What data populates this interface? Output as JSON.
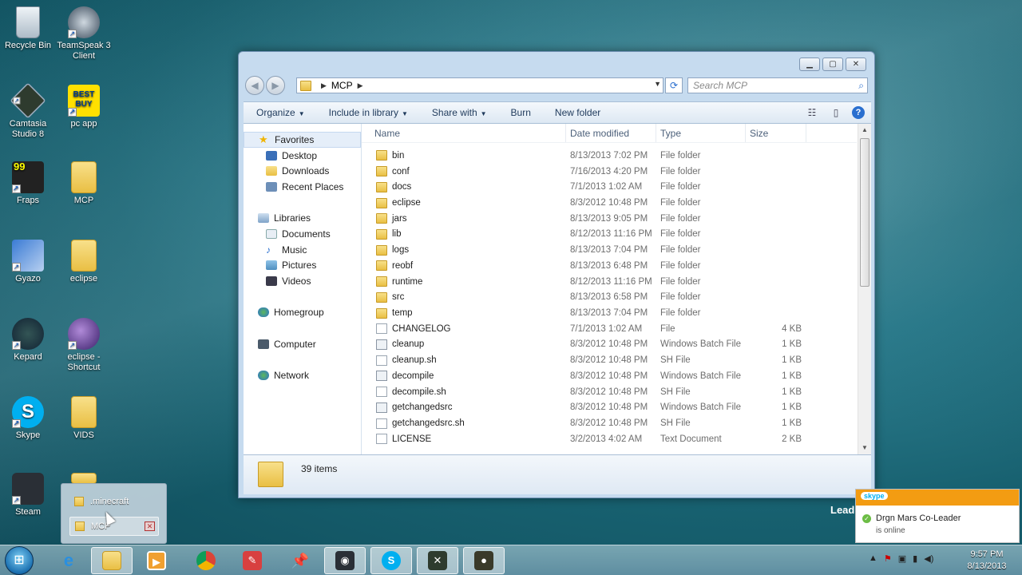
{
  "desktop": {
    "icons": [
      {
        "label": "Recycle Bin"
      },
      {
        "label": "TeamSpeak 3 Client"
      },
      {
        "label": "Camtasia Studio 8"
      },
      {
        "label": "pc app"
      },
      {
        "label": "Fraps"
      },
      {
        "label": "MCP"
      },
      {
        "label": "Gyazo"
      },
      {
        "label": "eclipse"
      },
      {
        "label": "Kepard"
      },
      {
        "label": "eclipse - Shortcut"
      },
      {
        "label": "Skype"
      },
      {
        "label": "VIDS"
      },
      {
        "label": "Steam"
      }
    ],
    "bestbuy_logo": "BEST BUY",
    "fraps_counter": "99",
    "lead_text": "Lead"
  },
  "explorer": {
    "breadcrumb": "MCP",
    "search_placeholder": "Search MCP",
    "toolbar": {
      "organize": "Organize",
      "include_in_library": "Include in library",
      "share_with": "Share with",
      "burn": "Burn",
      "new_folder": "New folder"
    },
    "nav": {
      "favorites": "Favorites",
      "desktop": "Desktop",
      "downloads": "Downloads",
      "recent_places": "Recent Places",
      "libraries": "Libraries",
      "documents": "Documents",
      "music": "Music",
      "pictures": "Pictures",
      "videos": "Videos",
      "homegroup": "Homegroup",
      "computer": "Computer",
      "network": "Network"
    },
    "columns": {
      "name": "Name",
      "date_modified": "Date modified",
      "type": "Type",
      "size": "Size"
    },
    "files": [
      {
        "name": "bin",
        "date": "8/13/2013 7:02 PM",
        "type": "File folder",
        "size": "",
        "icon": "folder"
      },
      {
        "name": "conf",
        "date": "7/16/2013 4:20 PM",
        "type": "File folder",
        "size": "",
        "icon": "folder"
      },
      {
        "name": "docs",
        "date": "7/1/2013 1:02 AM",
        "type": "File folder",
        "size": "",
        "icon": "folder"
      },
      {
        "name": "eclipse",
        "date": "8/3/2012 10:48 PM",
        "type": "File folder",
        "size": "",
        "icon": "folder"
      },
      {
        "name": "jars",
        "date": "8/13/2013 9:05 PM",
        "type": "File folder",
        "size": "",
        "icon": "folder"
      },
      {
        "name": "lib",
        "date": "8/12/2013 11:16 PM",
        "type": "File folder",
        "size": "",
        "icon": "folder"
      },
      {
        "name": "logs",
        "date": "8/13/2013 7:04 PM",
        "type": "File folder",
        "size": "",
        "icon": "folder"
      },
      {
        "name": "reobf",
        "date": "8/13/2013 6:48 PM",
        "type": "File folder",
        "size": "",
        "icon": "folder"
      },
      {
        "name": "runtime",
        "date": "8/12/2013 11:16 PM",
        "type": "File folder",
        "size": "",
        "icon": "folder"
      },
      {
        "name": "src",
        "date": "8/13/2013 6:58 PM",
        "type": "File folder",
        "size": "",
        "icon": "folder"
      },
      {
        "name": "temp",
        "date": "8/13/2013 7:04 PM",
        "type": "File folder",
        "size": "",
        "icon": "folder"
      },
      {
        "name": "CHANGELOG",
        "date": "7/1/2013 1:02 AM",
        "type": "File",
        "size": "4 KB",
        "icon": "file"
      },
      {
        "name": "cleanup",
        "date": "8/3/2012 10:48 PM",
        "type": "Windows Batch File",
        "size": "1 KB",
        "icon": "batch"
      },
      {
        "name": "cleanup.sh",
        "date": "8/3/2012 10:48 PM",
        "type": "SH File",
        "size": "1 KB",
        "icon": "file"
      },
      {
        "name": "decompile",
        "date": "8/3/2012 10:48 PM",
        "type": "Windows Batch File",
        "size": "1 KB",
        "icon": "batch"
      },
      {
        "name": "decompile.sh",
        "date": "8/3/2012 10:48 PM",
        "type": "SH File",
        "size": "1 KB",
        "icon": "file"
      },
      {
        "name": "getchangedsrc",
        "date": "8/3/2012 10:48 PM",
        "type": "Windows Batch File",
        "size": "1 KB",
        "icon": "batch"
      },
      {
        "name": "getchangedsrc.sh",
        "date": "8/3/2012 10:48 PM",
        "type": "SH File",
        "size": "1 KB",
        "icon": "file"
      },
      {
        "name": "LICENSE",
        "date": "3/2/2013 4:02 AM",
        "type": "Text Document",
        "size": "2 KB",
        "icon": "file"
      }
    ],
    "item_count": "39 items"
  },
  "jumplist": {
    "items": [
      ".minecraft",
      "MCP"
    ]
  },
  "skype_notification": {
    "logo": "skype",
    "contact": "Drgn Mars Co-Leader",
    "status": "is online"
  },
  "taskbar": {
    "time": "9:57 PM",
    "date": "8/13/2013"
  },
  "colors": {
    "window_frame": "#c6dbef",
    "skype_orange": "#f39c12",
    "skype_blue": "#00aff0"
  }
}
